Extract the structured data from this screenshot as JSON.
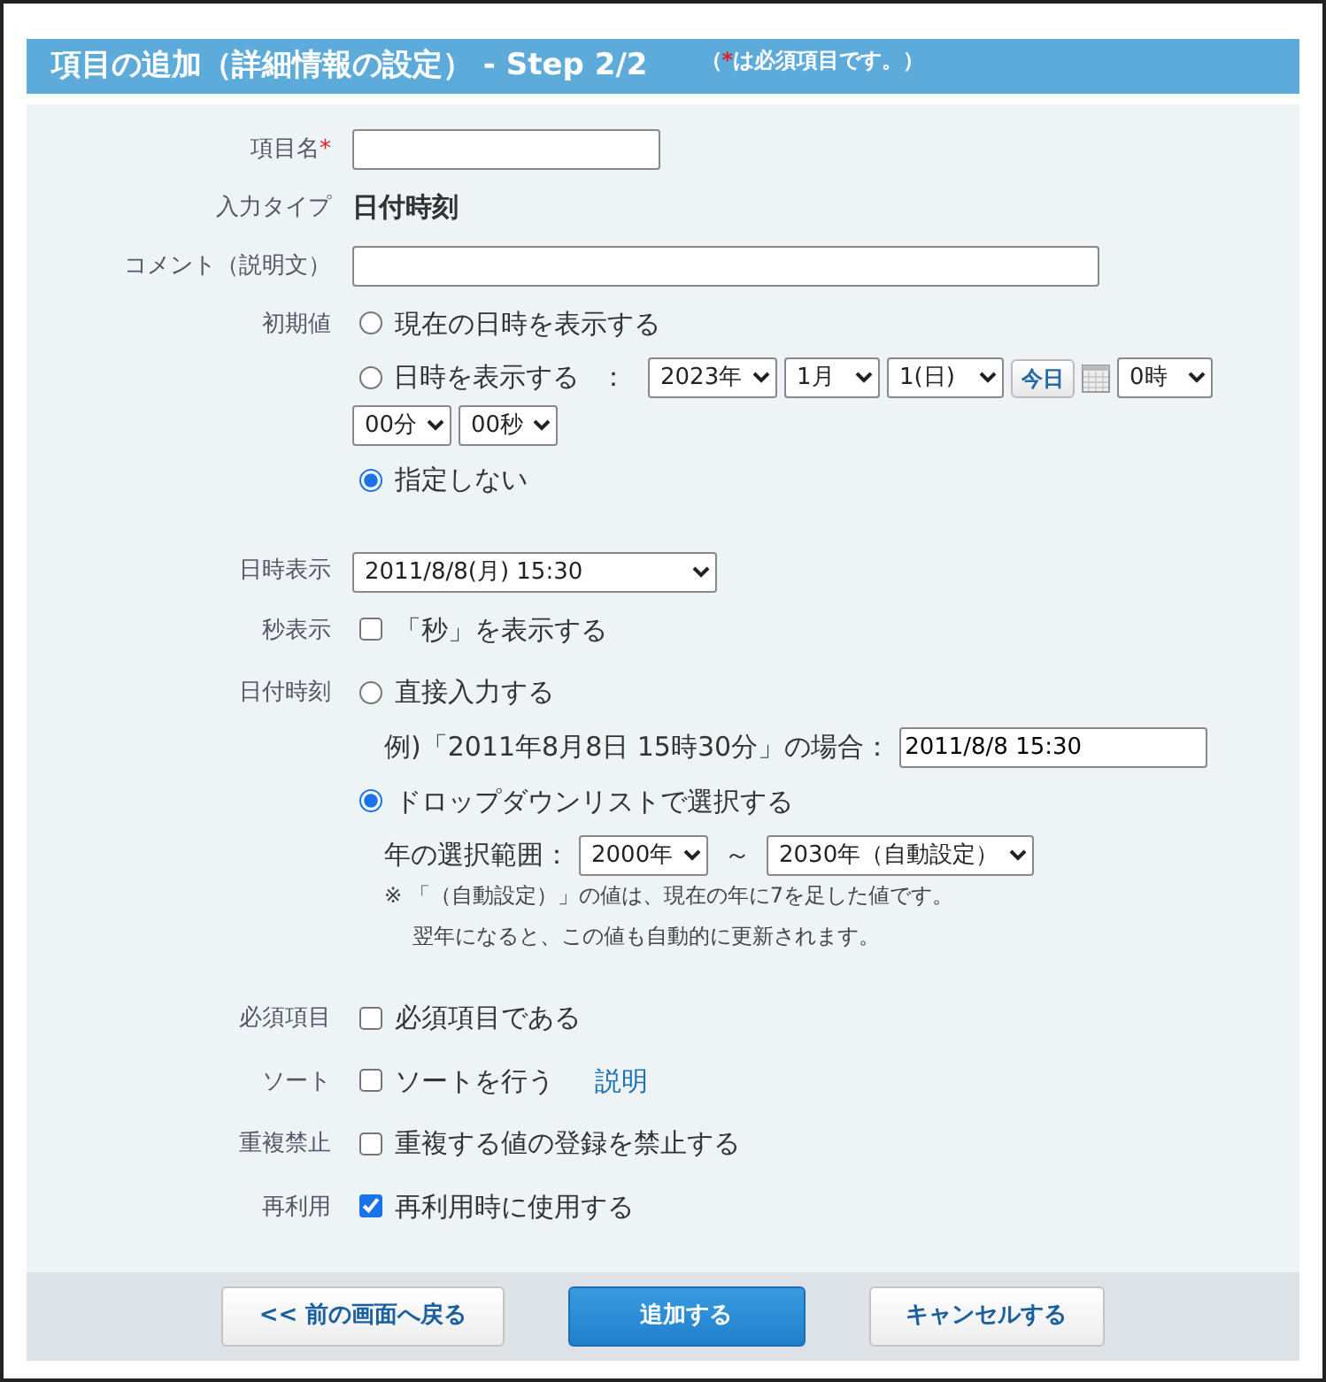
{
  "header": {
    "title": "項目の追加（詳細情報の設定） - Step 2/2",
    "note_open": "（",
    "note_mark": "*",
    "note_text": "は必須項目です。）"
  },
  "fields": [
    {
      "kind": "short_text",
      "label": "項目名",
      "required": true
    },
    {
      "kind": "static",
      "label": "入力タイプ",
      "value": "日付時刻"
    },
    {
      "kind": "long_text",
      "label": "コメント（説明文）"
    },
    {
      "kind": "radio_group",
      "label": "初期値",
      "options": [
        {
          "label": "現在の日時を表示する",
          "selected": false
        },
        {
          "label": "日時を表示する",
          "selected": false,
          "suffix": "：",
          "date_selects": [
            "2023年",
            "1月",
            "1(日)"
          ],
          "today_button": "今日",
          "time_selects": [
            "0時",
            "00分",
            "00秒"
          ]
        },
        {
          "label": "指定しない",
          "selected": true
        }
      ]
    },
    {
      "kind": "select",
      "label": "日時表示",
      "value": "2011/8/8(月) 15:30"
    },
    {
      "kind": "checkbox",
      "label": "秒表示",
      "text": "「秒」を表示する",
      "checked": false
    },
    {
      "kind": "radio_group",
      "label": "日付時刻",
      "options": [
        {
          "label": "直接入力する",
          "selected": false,
          "example": {
            "text": "例)「2011年8月8日 15時30分」の場合：",
            "value": "2011/8/8 15:30"
          }
        },
        {
          "label": "ドロップダウンリストで選択する",
          "selected": true,
          "range": {
            "label": "年の選択範囲：",
            "from": "2000年",
            "separator": "～",
            "to": "2030年（自動設定）",
            "notes": [
              "※ 「（自動設定）」の値は、現在の年に7を足した値です。",
              "翌年になると、この値も自動的に更新されます。"
            ]
          }
        }
      ]
    },
    {
      "kind": "checkbox",
      "label": "必須項目",
      "text": "必須項目である",
      "checked": false
    },
    {
      "kind": "checkbox",
      "label": "ソート",
      "text": "ソートを行う",
      "checked": false,
      "link": "説明"
    },
    {
      "kind": "checkbox",
      "label": "重複禁止",
      "text": "重複する値の登録を禁止する",
      "checked": false
    },
    {
      "kind": "checkbox",
      "label": "再利用",
      "text": "再利用時に使用する",
      "checked": true
    }
  ],
  "buttons": [
    {
      "label": "<< 前の画面へ戻る",
      "kind": "secondary"
    },
    {
      "label": "追加する",
      "kind": "primary"
    },
    {
      "label": "キャンセルする",
      "kind": "secondary"
    }
  ]
}
